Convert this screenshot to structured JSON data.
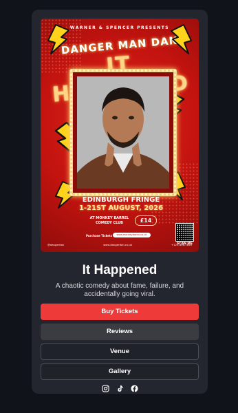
{
  "poster": {
    "presents": "WARNER & SPENCER PRESENTS",
    "performer": "DANGER MAN DAN",
    "show_title_neon": "IT HAPPENED",
    "festival": "EDINBURGH FRINGE",
    "dates": "1-21ST AUGUST, 2026",
    "venue_line1": "AT MONKEY BARREL",
    "venue_line2": "COMEDY CLUB",
    "price": "£14",
    "purchase_label": "Purchase Tickets At",
    "purchase_url": "www.monkeybarrel.co.uk",
    "handle": "@dangerdan",
    "website": "www.dangerdan.co.uk",
    "phone": "+123-456-7890",
    "scan_label": "SCAN ME"
  },
  "show": {
    "title": "It Happened",
    "description": "A chaotic comedy about fame, failure, and accidentally going viral."
  },
  "buttons": {
    "buy": "Buy Tickets",
    "reviews": "Reviews",
    "venue": "Venue",
    "gallery": "Gallery"
  },
  "socials": [
    "instagram-icon",
    "tiktok-icon",
    "facebook-icon"
  ],
  "colors": {
    "page_bg": "#11131a",
    "card_bg": "#23262e",
    "accent": "#ef3a3a",
    "poster_red": "#c2130f"
  }
}
